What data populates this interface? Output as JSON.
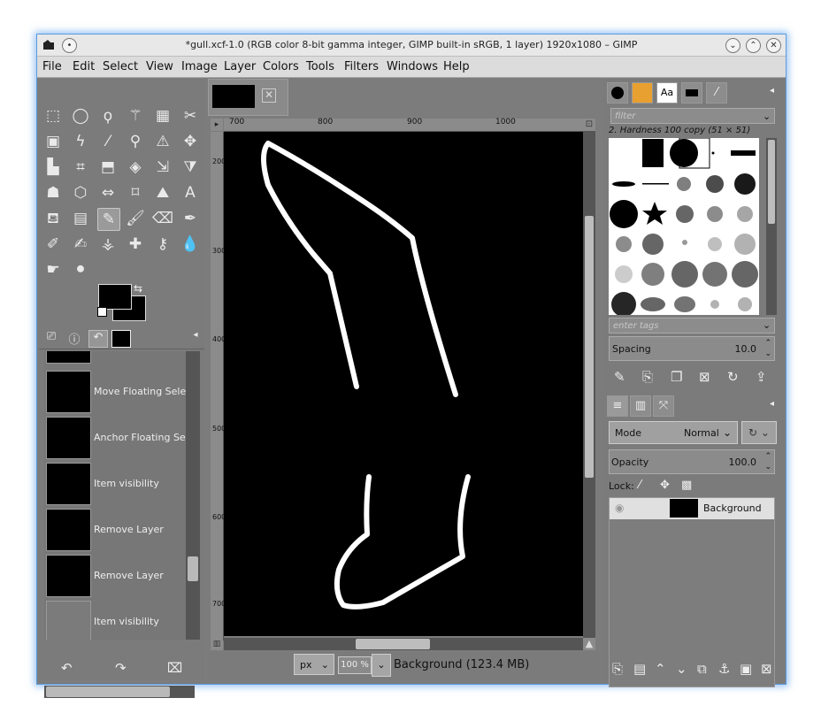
{
  "window": {
    "title": "*gull.xcf-1.0 (RGB color 8-bit gamma integer, GIMP built-in sRGB, 1 layer) 1920x1080 – GIMP"
  },
  "menu": [
    {
      "label": "File"
    },
    {
      "label": "Edit"
    },
    {
      "label": "Select"
    },
    {
      "label": "View"
    },
    {
      "label": "Image"
    },
    {
      "label": "Layer"
    },
    {
      "label": "Colors"
    },
    {
      "label": "Tools"
    },
    {
      "label": "Filters"
    },
    {
      "label": "Windows"
    },
    {
      "label": "Help"
    }
  ],
  "history": {
    "items": [
      {
        "label": "Move Floating Selecti"
      },
      {
        "label": "Anchor Floating Selec"
      },
      {
        "label": "Item visibility"
      },
      {
        "label": "Remove Layer"
      },
      {
        "label": "Remove Layer"
      },
      {
        "label": "Item visibility"
      }
    ]
  },
  "rulers": {
    "h": [
      "700",
      "800",
      "900",
      "1000"
    ],
    "v": [
      "200",
      "300",
      "400",
      "500",
      "600",
      "700"
    ]
  },
  "status": {
    "unit": "px",
    "zoom": "100 %",
    "text": "Background (123.4 MB)"
  },
  "brushes": {
    "filter_placeholder": "filter",
    "selected": "2. Hardness 100 copy (51 × 51)",
    "tags_placeholder": "enter tags",
    "spacing_label": "Spacing",
    "spacing_value": "10.0"
  },
  "layers": {
    "mode_label": "Mode",
    "mode_value": "Normal",
    "opacity_label": "Opacity",
    "opacity_value": "100.0",
    "lock_label": "Lock:",
    "items": [
      {
        "name": "Background"
      }
    ]
  },
  "colors": {
    "foreground": "#000000",
    "background": "#000000",
    "canvas": "#000000",
    "stroke": "#ffffff"
  }
}
